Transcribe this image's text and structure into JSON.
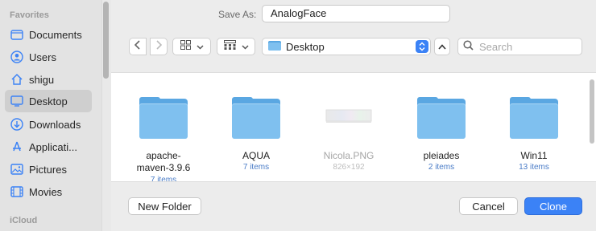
{
  "sidebar": {
    "favorites_label": "Favorites",
    "icloud_label": "iCloud",
    "items": [
      {
        "label": "Documents",
        "icon": "document-folder-icon"
      },
      {
        "label": "Users",
        "icon": "user-circle-icon"
      },
      {
        "label": "shigu",
        "icon": "home-icon"
      },
      {
        "label": "Desktop",
        "icon": "desktop-icon",
        "selected": true
      },
      {
        "label": "Downloads",
        "icon": "download-icon"
      },
      {
        "label": "Applicati...",
        "icon": "applications-icon"
      },
      {
        "label": "Pictures",
        "icon": "pictures-icon"
      },
      {
        "label": "Movies",
        "icon": "movies-icon"
      }
    ]
  },
  "dialog": {
    "save_as_label": "Save As:",
    "save_as_value": "AnalogFace",
    "location": "Desktop",
    "search_placeholder": "Search",
    "new_folder_label": "New Folder",
    "cancel_label": "Cancel",
    "confirm_label": "Clone"
  },
  "files": [
    {
      "name": "apache-\nmaven-3.9.6",
      "meta": "7 items",
      "type": "folder"
    },
    {
      "name": "AQUA",
      "meta": "7 items",
      "type": "folder"
    },
    {
      "name": "Nicola.PNG",
      "meta": "826×192",
      "type": "image",
      "dimmed": true
    },
    {
      "name": "pleiades",
      "meta": "2 items",
      "type": "folder"
    },
    {
      "name": "Win11",
      "meta": "13 items",
      "type": "folder"
    }
  ],
  "colors": {
    "accent": "#3b82f6",
    "folder": "#7fc0ef"
  }
}
